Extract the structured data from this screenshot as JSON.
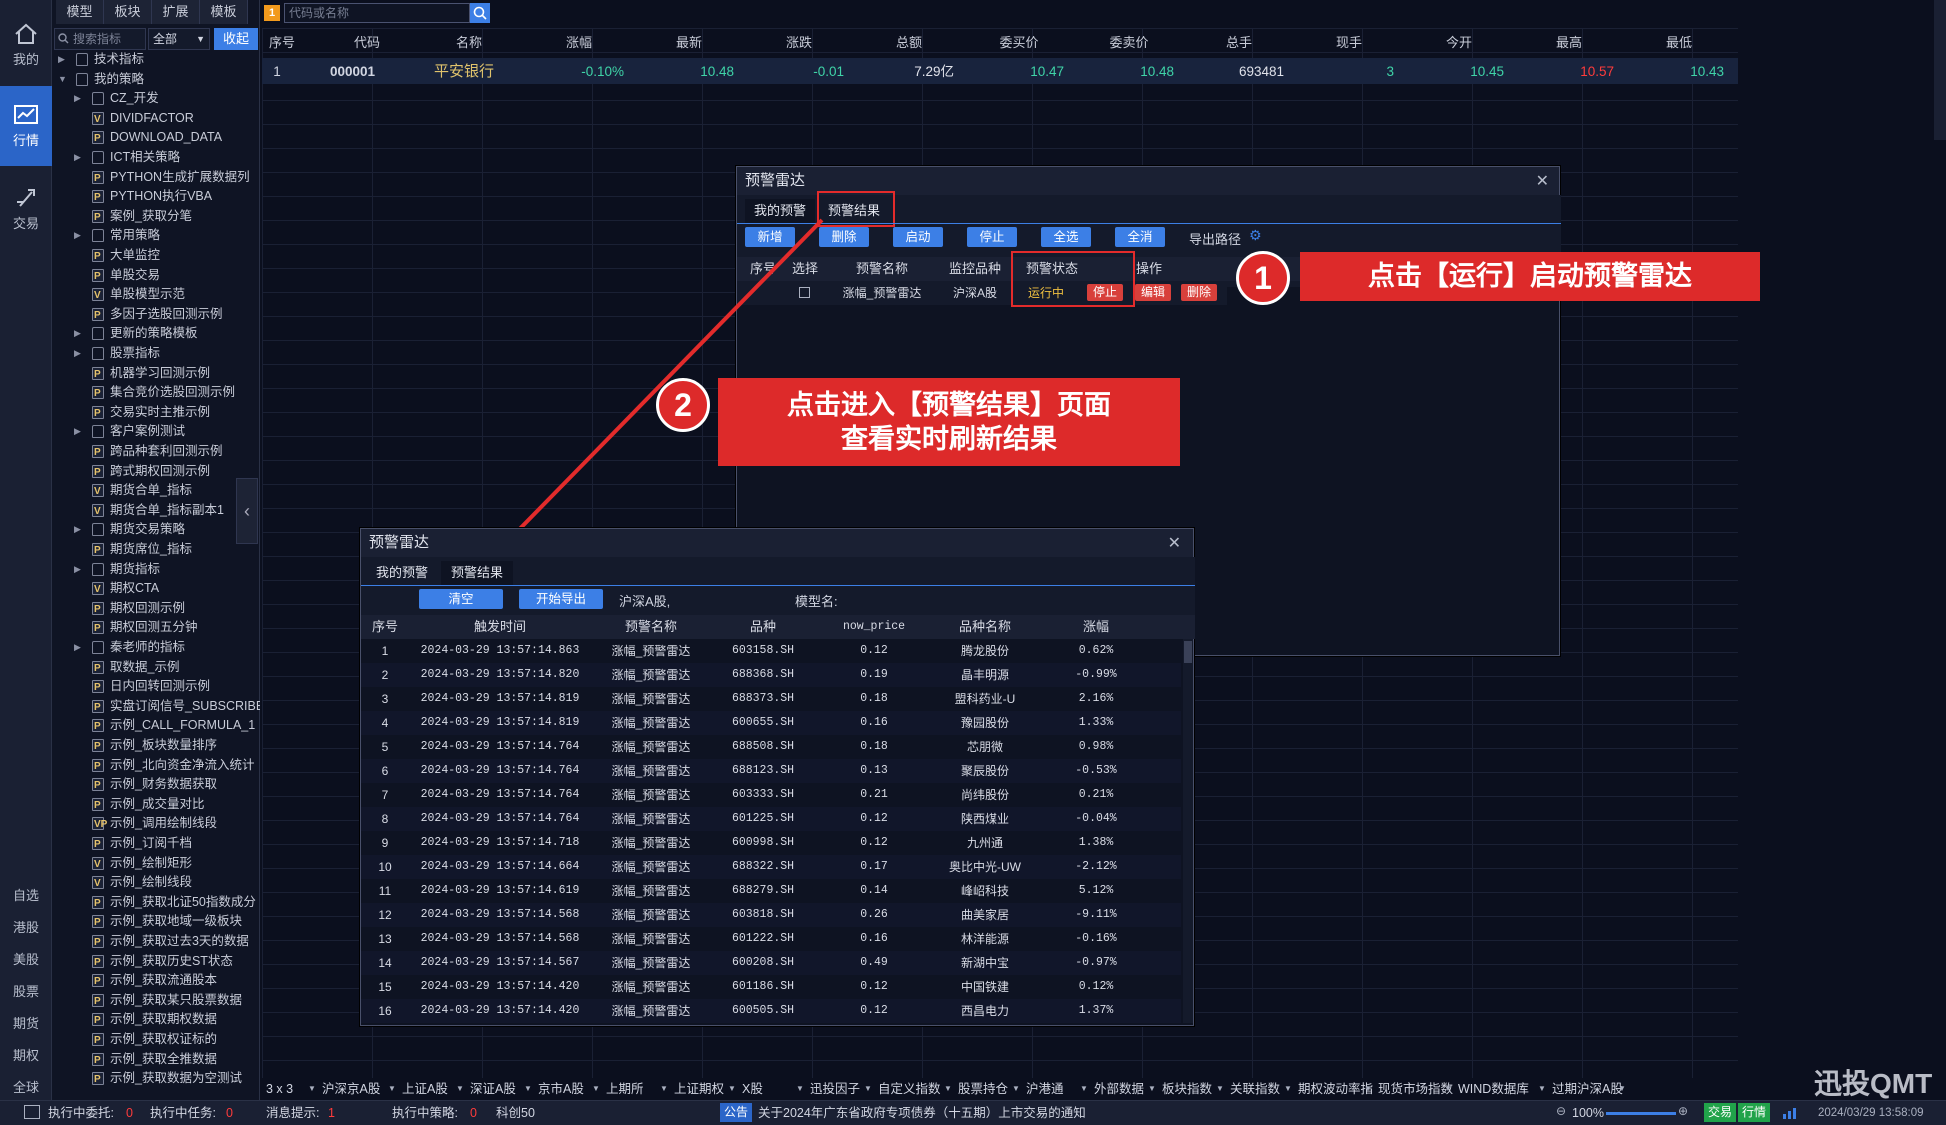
{
  "rail": {
    "top_items": [
      {
        "label": "我的"
      },
      {
        "label": "行情"
      },
      {
        "label": "交易"
      }
    ],
    "bottom_items": [
      "自选",
      "港股",
      "美股",
      "股票",
      "期货",
      "期权",
      "全球"
    ]
  },
  "tree": {
    "tabs": [
      "模型",
      "板块",
      "扩展",
      "模板"
    ],
    "search_placeholder": "搜索指标",
    "filter_value": "全部",
    "collapse_label": "收起",
    "rows": [
      {
        "label": "技术指标",
        "type": "folder",
        "level": 0,
        "state": "collapsed"
      },
      {
        "label": "我的策略",
        "type": "folder",
        "level": 0,
        "state": "expanded"
      },
      {
        "label": "CZ_开发",
        "type": "folder",
        "level": 1,
        "state": "collapsed"
      },
      {
        "label": "DIVIDFACTOR",
        "type": "file",
        "level": 1,
        "badge": "V"
      },
      {
        "label": "DOWNLOAD_DATA",
        "type": "file",
        "level": 1,
        "badge": "P"
      },
      {
        "label": "ICT相关策略",
        "type": "folder",
        "level": 1,
        "state": "collapsed"
      },
      {
        "label": "PYTHON生成扩展数据列",
        "type": "file",
        "level": 1,
        "badge": "P"
      },
      {
        "label": "PYTHON执行VBA",
        "type": "file",
        "level": 1,
        "badge": "P"
      },
      {
        "label": "案例_获取分笔",
        "type": "file",
        "level": 1,
        "badge": "P"
      },
      {
        "label": "常用策略",
        "type": "folder",
        "level": 1,
        "state": "collapsed"
      },
      {
        "label": "大单监控",
        "type": "file",
        "level": 1,
        "badge": "P"
      },
      {
        "label": "单股交易",
        "type": "file",
        "level": 1,
        "badge": "P"
      },
      {
        "label": "单股模型示范",
        "type": "file",
        "level": 1,
        "badge": "V"
      },
      {
        "label": "多因子选股回测示例",
        "type": "file",
        "level": 1,
        "badge": "P"
      },
      {
        "label": "更新的策略模板",
        "type": "folder",
        "level": 1,
        "state": "collapsed"
      },
      {
        "label": "股票指标",
        "type": "folder",
        "level": 1,
        "state": "collapsed"
      },
      {
        "label": "机器学习回测示例",
        "type": "file",
        "level": 1,
        "badge": "P"
      },
      {
        "label": "集合竞价选股回测示例",
        "type": "file",
        "level": 1,
        "badge": "P"
      },
      {
        "label": "交易实时主推示例",
        "type": "file",
        "level": 1,
        "badge": "P"
      },
      {
        "label": "客户案例测试",
        "type": "folder",
        "level": 1,
        "state": "collapsed"
      },
      {
        "label": "跨品种套利回测示例",
        "type": "file",
        "level": 1,
        "badge": "P"
      },
      {
        "label": "跨式期权回测示例",
        "type": "file",
        "level": 1,
        "badge": "P"
      },
      {
        "label": "期货合单_指标",
        "type": "file",
        "level": 1,
        "badge": "V"
      },
      {
        "label": "期货合单_指标副本1",
        "type": "file",
        "level": 1,
        "badge": "V"
      },
      {
        "label": "期货交易策略",
        "type": "folder",
        "level": 1,
        "state": "collapsed"
      },
      {
        "label": "期货席位_指标",
        "type": "file",
        "level": 1,
        "badge": "P"
      },
      {
        "label": "期货指标",
        "type": "folder",
        "level": 1,
        "state": "collapsed"
      },
      {
        "label": "期权CTA",
        "type": "file",
        "level": 1,
        "badge": "V"
      },
      {
        "label": "期权回测示例",
        "type": "file",
        "level": 1,
        "badge": "P"
      },
      {
        "label": "期权回测五分钟",
        "type": "file",
        "level": 1,
        "badge": "P"
      },
      {
        "label": "秦老师的指标",
        "type": "folder",
        "level": 1,
        "state": "collapsed"
      },
      {
        "label": "取数据_示例",
        "type": "file",
        "level": 1,
        "badge": "P"
      },
      {
        "label": "日内回转回测示例",
        "type": "file",
        "level": 1,
        "badge": "P"
      },
      {
        "label": "实盘订阅信号_SUBSCRIBE",
        "type": "file",
        "level": 1,
        "badge": "P"
      },
      {
        "label": "示例_CALL_FORMULA_1",
        "type": "file",
        "level": 1,
        "badge": "P"
      },
      {
        "label": "示例_板块数量排序",
        "type": "file",
        "level": 1,
        "badge": "P"
      },
      {
        "label": "示例_北向资金净流入统计",
        "type": "file",
        "level": 1,
        "badge": "P"
      },
      {
        "label": "示例_财务数据获取",
        "type": "file",
        "level": 1,
        "badge": "P"
      },
      {
        "label": "示例_成交量对比",
        "type": "file",
        "level": 1,
        "badge": "P"
      },
      {
        "label": "示例_调用绘制线段",
        "type": "file",
        "level": 1,
        "badge": "VP"
      },
      {
        "label": "示例_订阅千档",
        "type": "file",
        "level": 1,
        "badge": "P"
      },
      {
        "label": "示例_绘制矩形",
        "type": "file",
        "level": 1,
        "badge": "V"
      },
      {
        "label": "示例_绘制线段",
        "type": "file",
        "level": 1,
        "badge": "V"
      },
      {
        "label": "示例_获取北证50指数成分",
        "type": "file",
        "level": 1,
        "badge": "P"
      },
      {
        "label": "示例_获取地域一级板块",
        "type": "file",
        "level": 1,
        "badge": "P"
      },
      {
        "label": "示例_获取过去3天的数据",
        "type": "file",
        "level": 1,
        "badge": "P"
      },
      {
        "label": "示例_获取历史ST状态",
        "type": "file",
        "level": 1,
        "badge": "P"
      },
      {
        "label": "示例_获取流通股本",
        "type": "file",
        "level": 1,
        "badge": "P"
      },
      {
        "label": "示例_获取某只股票数据",
        "type": "file",
        "level": 1,
        "badge": "P"
      },
      {
        "label": "示例_获取期权数据",
        "type": "file",
        "level": 1,
        "badge": "P"
      },
      {
        "label": "示例_获取权证标的",
        "type": "file",
        "level": 1,
        "badge": "P"
      },
      {
        "label": "示例_获取全推数据",
        "type": "file",
        "level": 1,
        "badge": "P"
      },
      {
        "label": "示例_获取数据为空测试",
        "type": "file",
        "level": 1,
        "badge": "P"
      }
    ]
  },
  "topbar": {
    "badge": "1",
    "search_placeholder": "代码或名称"
  },
  "quote_table": {
    "headers": [
      "序号",
      "代码",
      "名称",
      "涨幅",
      "最新",
      "涨跌",
      "总额",
      "委买价",
      "委卖价",
      "总手",
      "现手",
      "今开",
      "最高",
      "最低"
    ],
    "row": [
      "1",
      "000001",
      "平安银行",
      "-0.10%",
      "10.48",
      "-0.01",
      "7.29亿",
      "10.47",
      "10.48",
      "693481",
      "3",
      "10.45",
      "10.57",
      "10.43"
    ]
  },
  "dialog1": {
    "title": "预警雷达",
    "tabs": [
      "我的预警",
      "预警结果"
    ],
    "buttons": [
      "新增",
      "删除",
      "启动",
      "停止",
      "全选",
      "全消"
    ],
    "export_label": "导出路径",
    "headers": [
      "序号",
      "选择",
      "预警名称",
      "监控品种",
      "预警状态",
      "操作"
    ],
    "row": {
      "name": "涨幅_预警雷达",
      "market": "沪深A股",
      "status": "运行中",
      "actions": [
        "停止",
        "编辑",
        "删除"
      ]
    }
  },
  "dialog2": {
    "title": "预警雷达",
    "tabs": [
      "我的预警",
      "预警结果"
    ],
    "clear_label": "清空",
    "export_label": "开始导出",
    "market_label": "沪深A股,",
    "model_label": "模型名:",
    "headers": [
      "序号",
      "触发时间",
      "预警名称",
      "品种",
      "now_price",
      "品种名称",
      "涨幅"
    ],
    "rows": [
      [
        "1",
        "2024-03-29 13:57:14.863",
        "涨幅_预警雷达",
        "603158.SH",
        "0.12",
        "腾龙股份",
        "0.62%"
      ],
      [
        "2",
        "2024-03-29 13:57:14.820",
        "涨幅_预警雷达",
        "688368.SH",
        "0.19",
        "晶丰明源",
        "-0.99%"
      ],
      [
        "3",
        "2024-03-29 13:57:14.819",
        "涨幅_预警雷达",
        "688373.SH",
        "0.18",
        "盟科药业-U",
        "2.16%"
      ],
      [
        "4",
        "2024-03-29 13:57:14.819",
        "涨幅_预警雷达",
        "600655.SH",
        "0.16",
        "豫园股份",
        "1.33%"
      ],
      [
        "5",
        "2024-03-29 13:57:14.764",
        "涨幅_预警雷达",
        "688508.SH",
        "0.18",
        "芯朋微",
        "0.98%"
      ],
      [
        "6",
        "2024-03-29 13:57:14.764",
        "涨幅_预警雷达",
        "688123.SH",
        "0.13",
        "聚辰股份",
        "-0.53%"
      ],
      [
        "7",
        "2024-03-29 13:57:14.764",
        "涨幅_预警雷达",
        "603333.SH",
        "0.21",
        "尚纬股份",
        "0.21%"
      ],
      [
        "8",
        "2024-03-29 13:57:14.764",
        "涨幅_预警雷达",
        "601225.SH",
        "0.12",
        "陕西煤业",
        "-0.04%"
      ],
      [
        "9",
        "2024-03-29 13:57:14.718",
        "涨幅_预警雷达",
        "600998.SH",
        "0.12",
        "九州通",
        "1.38%"
      ],
      [
        "10",
        "2024-03-29 13:57:14.664",
        "涨幅_预警雷达",
        "688322.SH",
        "0.17",
        "奥比中光-UW",
        "-2.12%"
      ],
      [
        "11",
        "2024-03-29 13:57:14.619",
        "涨幅_预警雷达",
        "688279.SH",
        "0.14",
        "峰岹科技",
        "5.12%"
      ],
      [
        "12",
        "2024-03-29 13:57:14.568",
        "涨幅_预警雷达",
        "603818.SH",
        "0.26",
        "曲美家居",
        "-9.11%"
      ],
      [
        "13",
        "2024-03-29 13:57:14.568",
        "涨幅_预警雷达",
        "601222.SH",
        "0.16",
        "林洋能源",
        "-0.16%"
      ],
      [
        "14",
        "2024-03-29 13:57:14.567",
        "涨幅_预警雷达",
        "600208.SH",
        "0.49",
        "新湖中宝",
        "-0.97%"
      ],
      [
        "15",
        "2024-03-29 13:57:14.420",
        "涨幅_预警雷达",
        "601186.SH",
        "0.12",
        "中国铁建",
        "0.12%"
      ],
      [
        "16",
        "2024-03-29 13:57:14.420",
        "涨幅_预警雷达",
        "600505.SH",
        "0.12",
        "西昌电力",
        "1.37%"
      ]
    ]
  },
  "callouts": {
    "c1_num": "1",
    "c1_text": "点击【运行】启动预警雷达",
    "c2_num": "2",
    "c2_line1": "点击进入【预警结果】页面",
    "c2_line2": "查看实时刷新结果"
  },
  "bottom_tabs": [
    "3 x 3",
    "沪深京A股",
    "上证A股",
    "深证A股",
    "京市A股",
    "上期所",
    "上证期权",
    "X股",
    "迅投因子",
    "自定义指数",
    "股票持仓",
    "沪港通",
    "外部数据",
    "板块指数",
    "关联指数",
    "期权波动率指",
    "现货市场指数",
    "WIND数据库",
    "过期沪深A股"
  ],
  "status": {
    "exec_delegate_label": "执行中委托:",
    "exec_delegate_val": "0",
    "exec_task_label": "执行中任务:",
    "exec_task_val": "0",
    "msg_label": "消息提示:",
    "msg_val": "1",
    "exec_strategy_label": "执行中策略:",
    "exec_strategy_val": "0",
    "sci_label": "科创50",
    "notice_badge": "公告",
    "notice_text": "关于2024年广东省政府专项债券（十五期）上市交易的通知",
    "zoom": "100%",
    "trade_badge": "交易",
    "quote_badge": "行情",
    "datetime": "2024/03/29 13:58:09"
  },
  "watermark": "迅投QMT",
  "colors": {
    "up": "#ff3b3b",
    "down": "#3fd4a8",
    "accent": "#3c7fe6",
    "callout": "#dd2a2a"
  }
}
